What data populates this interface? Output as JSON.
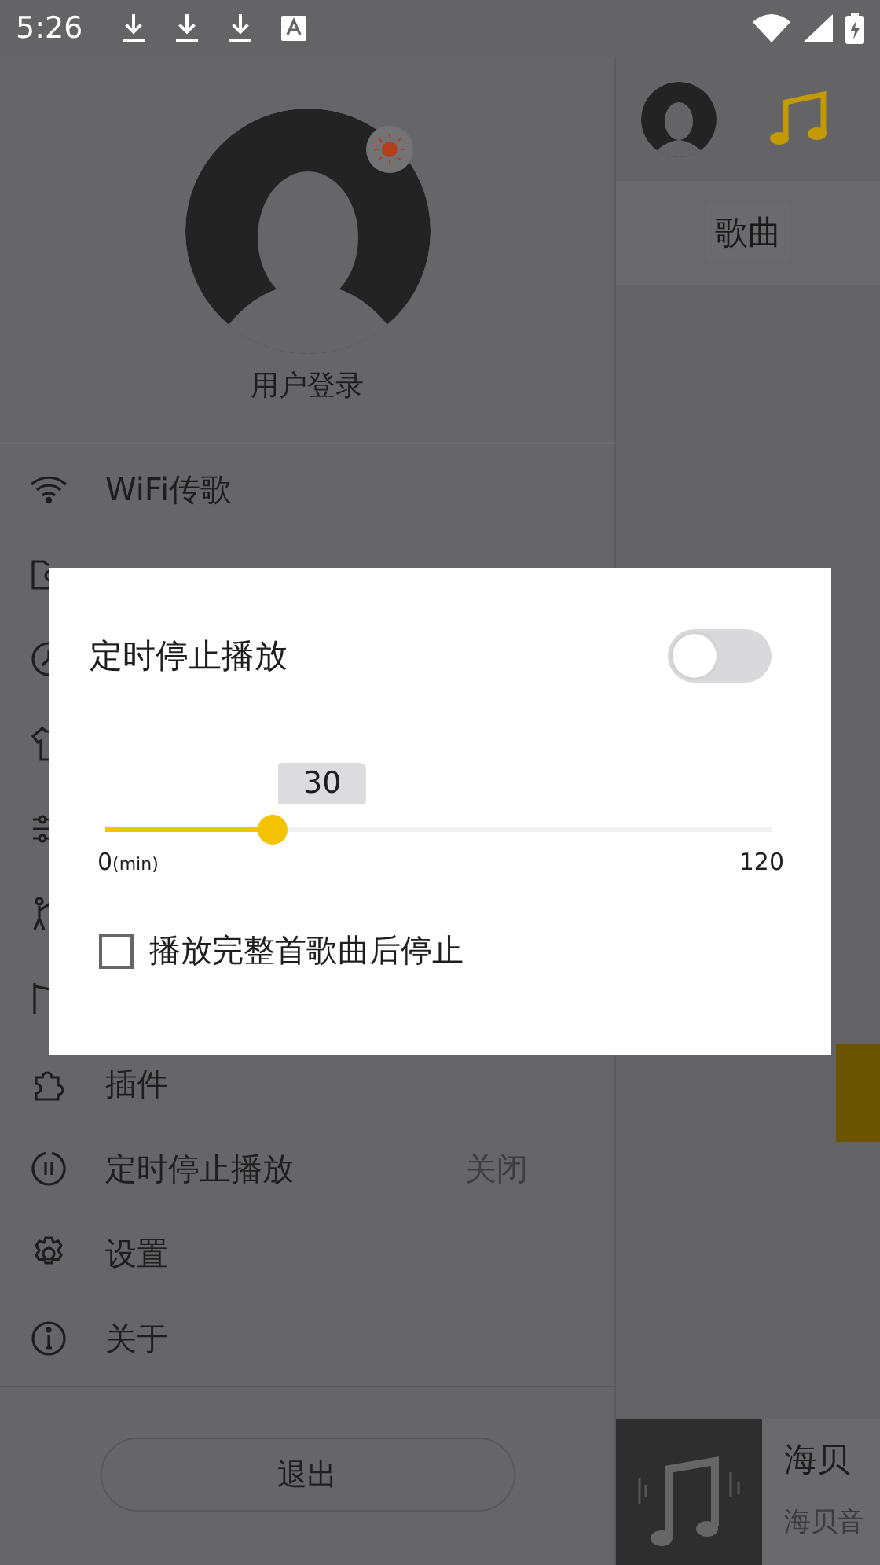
{
  "status_bar": {
    "time": "5:26"
  },
  "drawer": {
    "user_label": "用户登录",
    "items": [
      {
        "kind": "item",
        "label": "WiFi传歌"
      },
      {
        "kind": "covered"
      },
      {
        "kind": "covered"
      },
      {
        "kind": "covered"
      },
      {
        "kind": "covered"
      },
      {
        "kind": "covered"
      },
      {
        "kind": "covered"
      },
      {
        "kind": "item",
        "label": "插件"
      },
      {
        "kind": "item",
        "label": "定时停止播放",
        "value": "关闭"
      },
      {
        "kind": "item",
        "label": "设置"
      },
      {
        "kind": "item",
        "label": "关于"
      }
    ],
    "exit_button": "退出"
  },
  "main": {
    "tabs": [
      {
        "label": "歌曲",
        "selected": true
      }
    ],
    "player": {
      "title": "海贝",
      "subtitle": "海贝音"
    }
  },
  "dialog": {
    "title": "定时停止播放",
    "enabled": false,
    "slider": {
      "level": 0.25,
      "reading": "30",
      "min_label": "0",
      "min_unit": "(min)",
      "max_label": "120"
    },
    "option": {
      "label": "播放完整首歌曲后停止",
      "checked": false
    }
  }
}
